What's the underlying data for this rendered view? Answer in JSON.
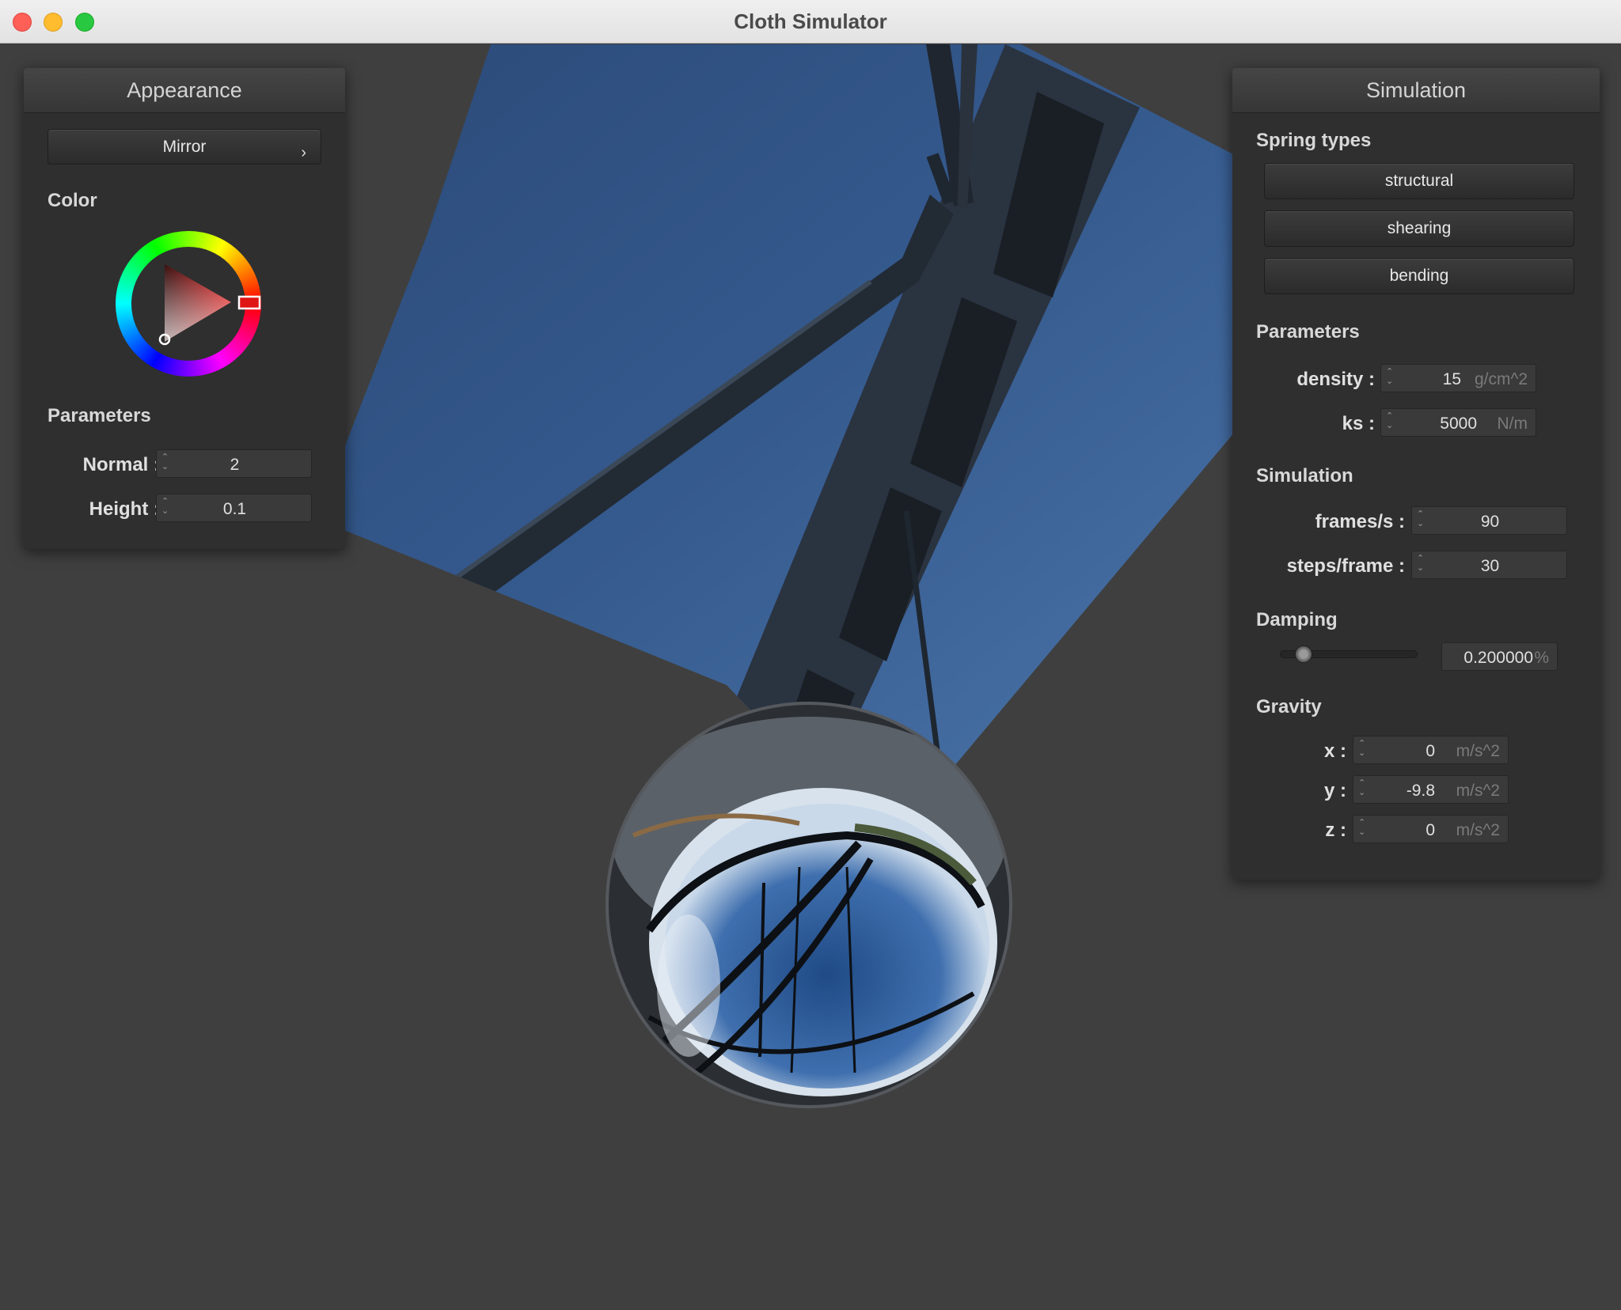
{
  "window": {
    "title": "Cloth Simulator"
  },
  "appearance": {
    "title": "Appearance",
    "shader_button": "Mirror",
    "color_label": "Color",
    "selected_color": "#e01515",
    "parameters_label": "Parameters",
    "normal_label": "Normal :",
    "normal_value": "2",
    "height_label": "Height :",
    "height_value": "0.1"
  },
  "simulation": {
    "title": "Simulation",
    "spring_types_label": "Spring types",
    "spring_buttons": [
      "structural",
      "shearing",
      "bending"
    ],
    "parameters_label": "Parameters",
    "density_label": "density :",
    "density_value": "15",
    "density_unit": "g/cm^2",
    "ks_label": "ks :",
    "ks_value": "5000",
    "ks_unit": "N/m",
    "simulation_label": "Simulation",
    "fps_label": "frames/s :",
    "fps_value": "90",
    "steps_label": "steps/frame :",
    "steps_value": "30",
    "damping_label": "Damping",
    "damping_value": "0.200000",
    "damping_unit": "%",
    "damping_level": 0.12,
    "gravity_label": "Gravity",
    "gx_label": "x :",
    "gx_value": "0",
    "gy_label": "y :",
    "gy_value": "-9.8",
    "gz_label": "z :",
    "gz_value": "0",
    "gravity_unit": "m/s^2"
  },
  "icons": {
    "shader_chevron": "chevron-right-icon",
    "spinner": "spinner-arrows-icon",
    "traffic_lights": [
      "close",
      "minimize",
      "maximize"
    ]
  }
}
